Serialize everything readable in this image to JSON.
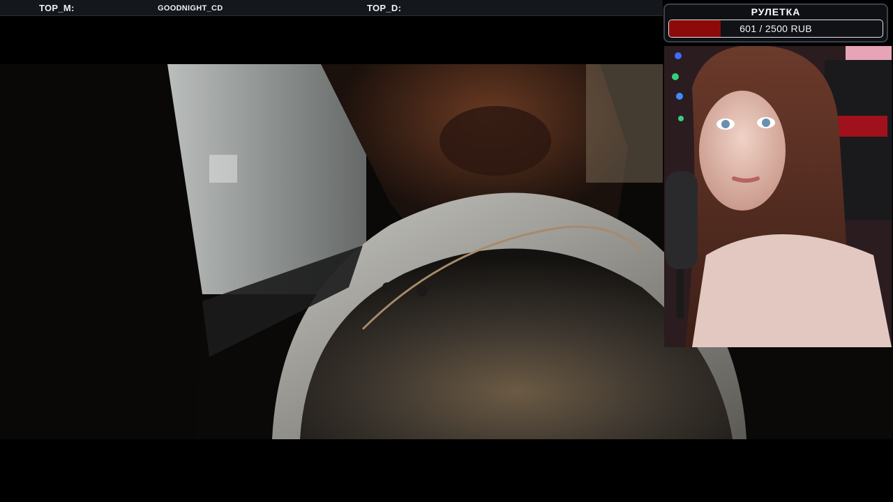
{
  "top_bar": {
    "top_m_label": "TOP_M:",
    "top_m_value": "GOODNIGHT_CD",
    "top_d_label": "TOP_D:",
    "top_d_value": ""
  },
  "roulette": {
    "title": "РУЛЕТКА",
    "current": 601,
    "goal": 2500,
    "progress_text": "601 / 2500 RUB",
    "fill_color": "#8d0a0a"
  },
  "webcam": {
    "icon": "streamer-webcam"
  },
  "video": {
    "icon": "music-video-frame"
  }
}
